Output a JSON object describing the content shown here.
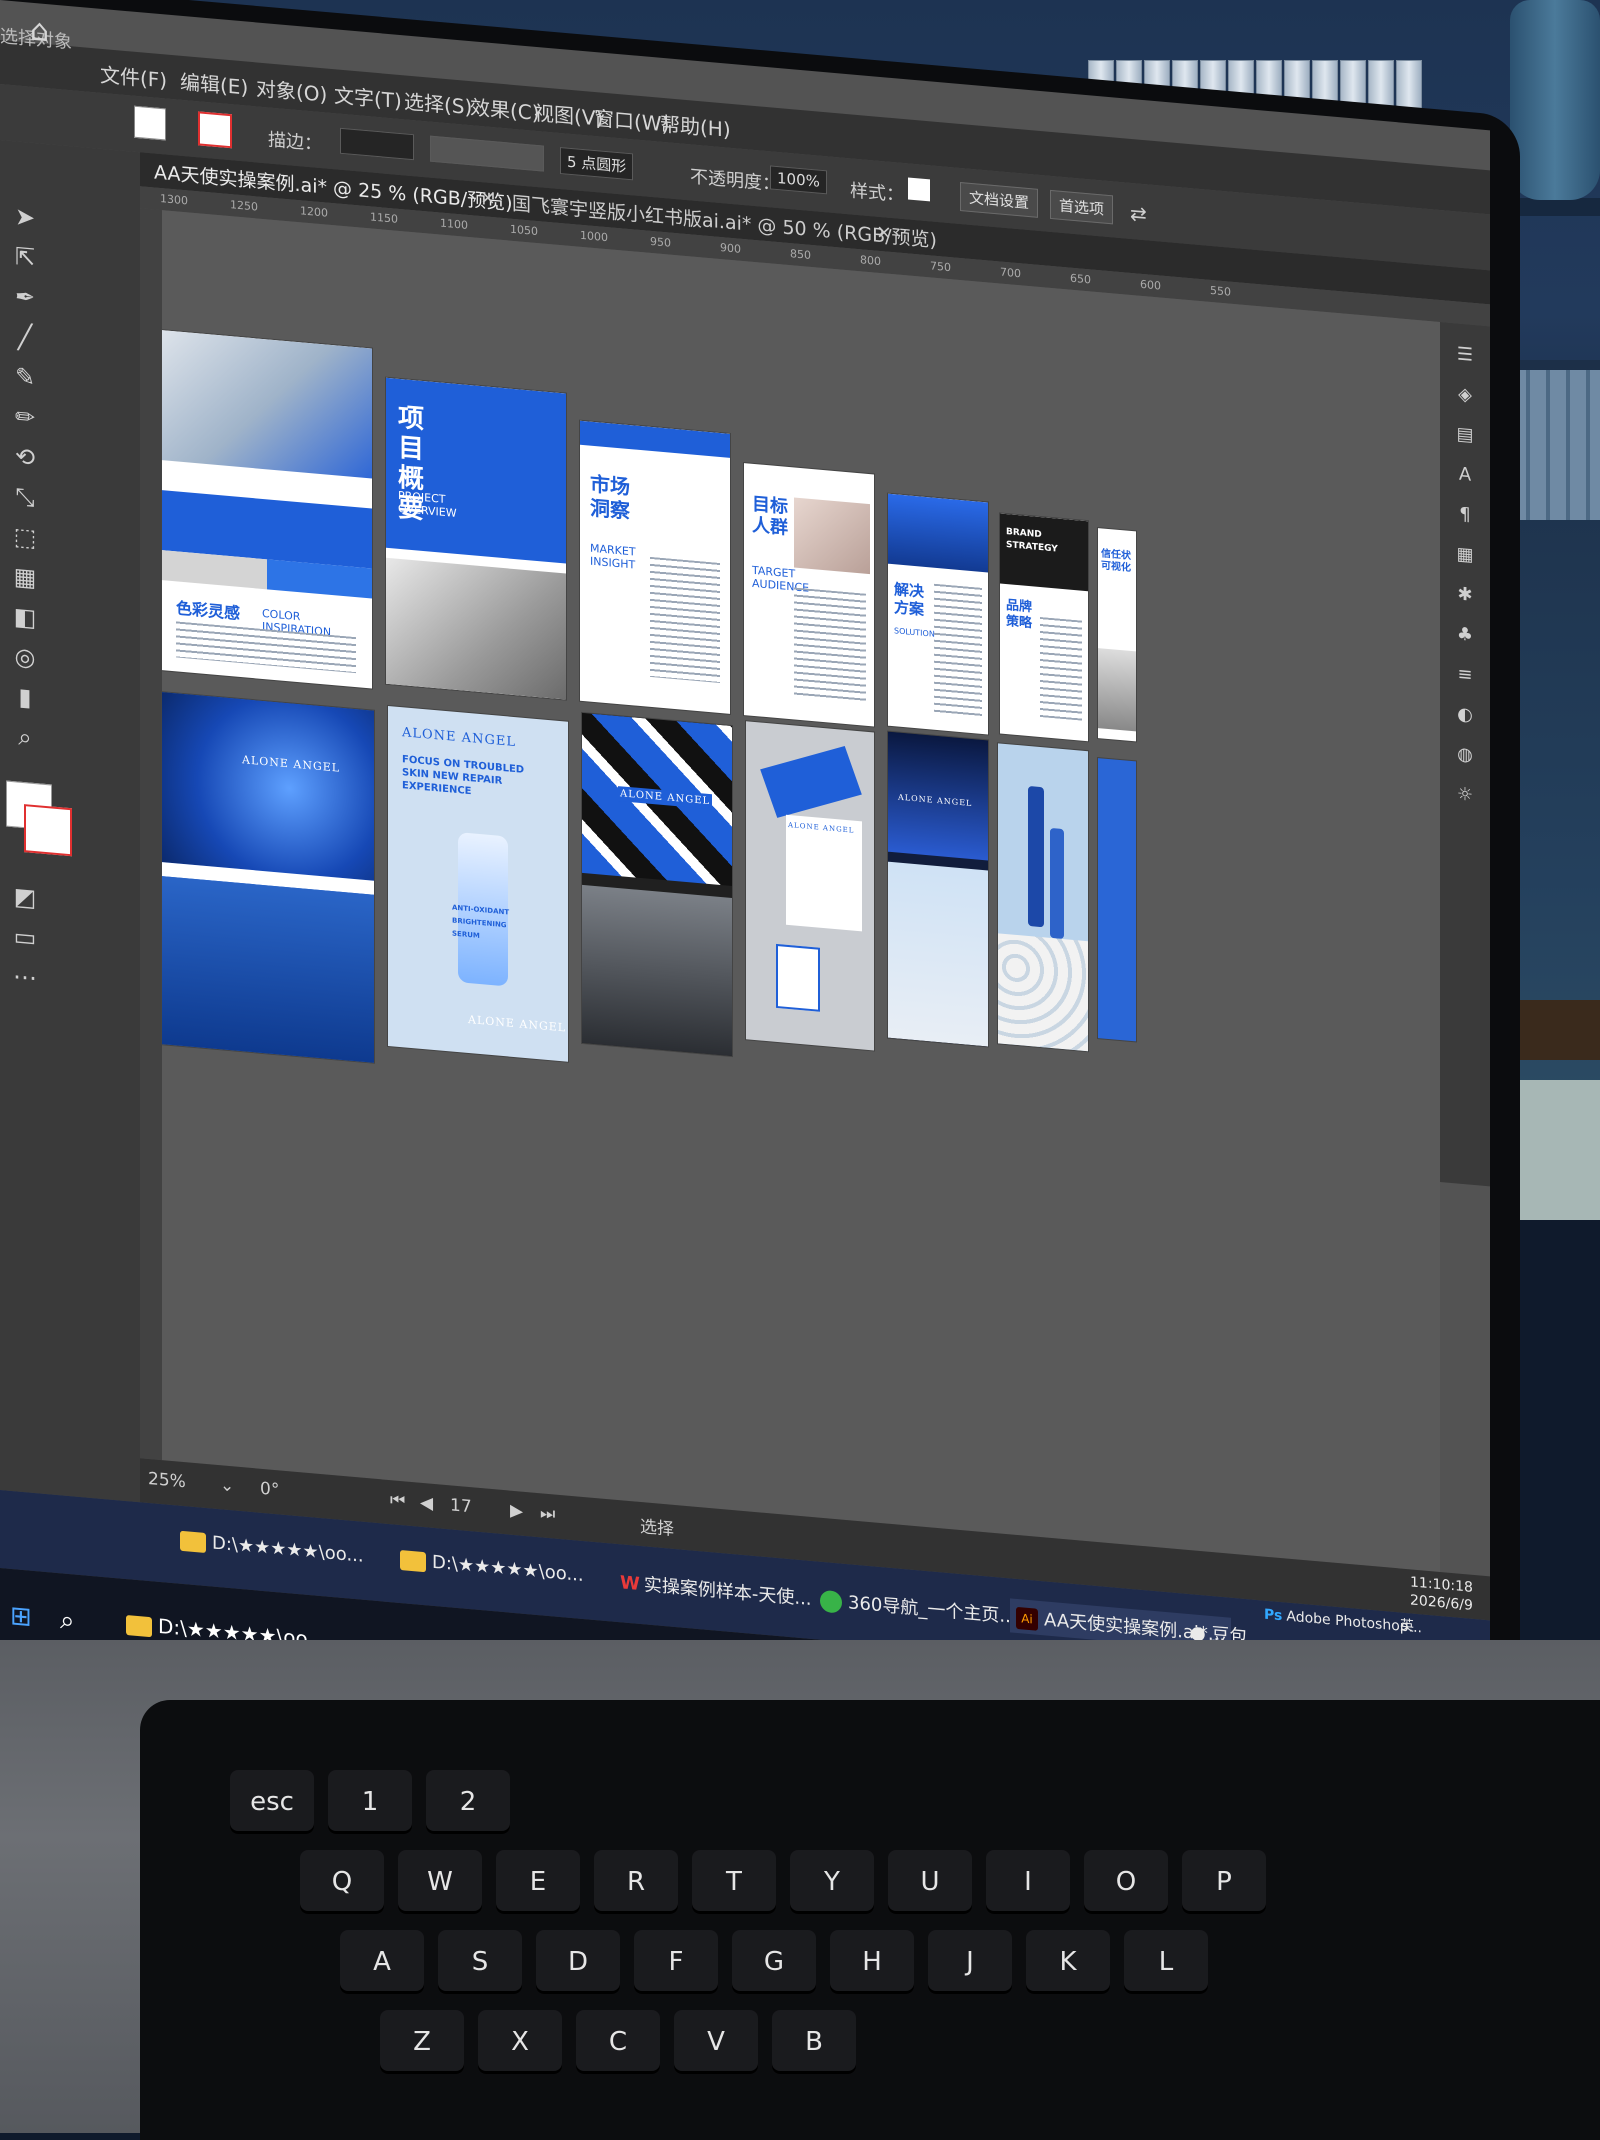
{
  "menubar": {
    "left_label": "选择对象",
    "items": [
      "文件(F)",
      "编辑(E)",
      "对象(O)",
      "文字(T)",
      "选择(S)",
      "效果(C)",
      "视图(V)",
      "窗口(W)",
      "帮助(H)"
    ]
  },
  "control": {
    "stroke_label": "描边：",
    "brush_value": "5 点圆形",
    "opacity_label": "不透明度：",
    "opacity_value": "100%",
    "style_label": "样式：",
    "doc_setup": "文档设置",
    "preferences": "首选项"
  },
  "tabs": [
    {
      "label": "AA天使实操案例.ai* @ 25 % (RGB/预览)",
      "close": "×"
    },
    {
      "label": "国飞寰宇竖版小红书版ai.ai* @ 50 % (RGB/预览)",
      "close": "×"
    }
  ],
  "ruler_ticks": [
    "1300",
    "1250",
    "1200",
    "1150",
    "1100",
    "1050",
    "1000",
    "950",
    "900",
    "850",
    "800",
    "750",
    "700",
    "650",
    "600",
    "550"
  ],
  "artboards": {
    "p1": {
      "title": "色彩灵感",
      "sub": "COLOR INSPIRATION"
    },
    "p2": {
      "title": "项目概要",
      "sub": "PROJECT OVERVIEW"
    },
    "p3": {
      "title": "市场洞察",
      "sub": "MARKET INSIGHT"
    },
    "p4": {
      "title": "目标人群",
      "sub": "TARGET AUDIENCE"
    },
    "p5": {
      "title": "解决方案",
      "sub": "SOLUTION"
    },
    "p6": {
      "title": "品牌策略",
      "sub": "BRAND STRATEGY"
    },
    "p7": {
      "title": "信任状可视化"
    },
    "p8": {
      "brand": "ALONE ANGEL"
    },
    "p9": {
      "brand": "ALONE ANGEL",
      "headline": "FOCUS ON TROUBLED SKIN NEW REPAIR EXPERIENCE",
      "product": "ANTI-OXIDANT BRIGHTENING SERUM"
    },
    "p10": {
      "brand": "ALONE ANGEL"
    },
    "p11": {
      "brand": "ALONE ANGEL"
    },
    "p12": {
      "brand": "ALONE ANGEL"
    }
  },
  "status": {
    "zoom": "25%",
    "rotation": "0°",
    "page": "17",
    "mode": "选择"
  },
  "taskbar": {
    "folder2": "D:\\★★★★★\\oo...",
    "folder3": "D:\\★★★★★\\oo...",
    "wps": "实操案例样本-天使...",
    "browser": "360导航_一个主页...",
    "ai_doc": "AA天使实操案例.ai*...",
    "user": "豆包",
    "photoshop": "Adobe Photoshop...",
    "ime": "英",
    "time": "11:10:18",
    "date": "2026/6/9"
  },
  "winbar": {
    "folder1": "D:\\★★★★★\\oo..."
  },
  "keys": [
    "esc",
    "1",
    "2",
    "Q",
    "W",
    "E",
    "R",
    "T",
    "Y",
    "U",
    "I",
    "O",
    "P",
    "A",
    "S",
    "D",
    "F",
    "G",
    "H",
    "J",
    "K",
    "L",
    "Z",
    "X",
    "C",
    "V",
    "B"
  ],
  "colors": {
    "accent": "#1f5fd8",
    "panel": "#3a3a3a",
    "canvas": "#5a5a5a"
  }
}
